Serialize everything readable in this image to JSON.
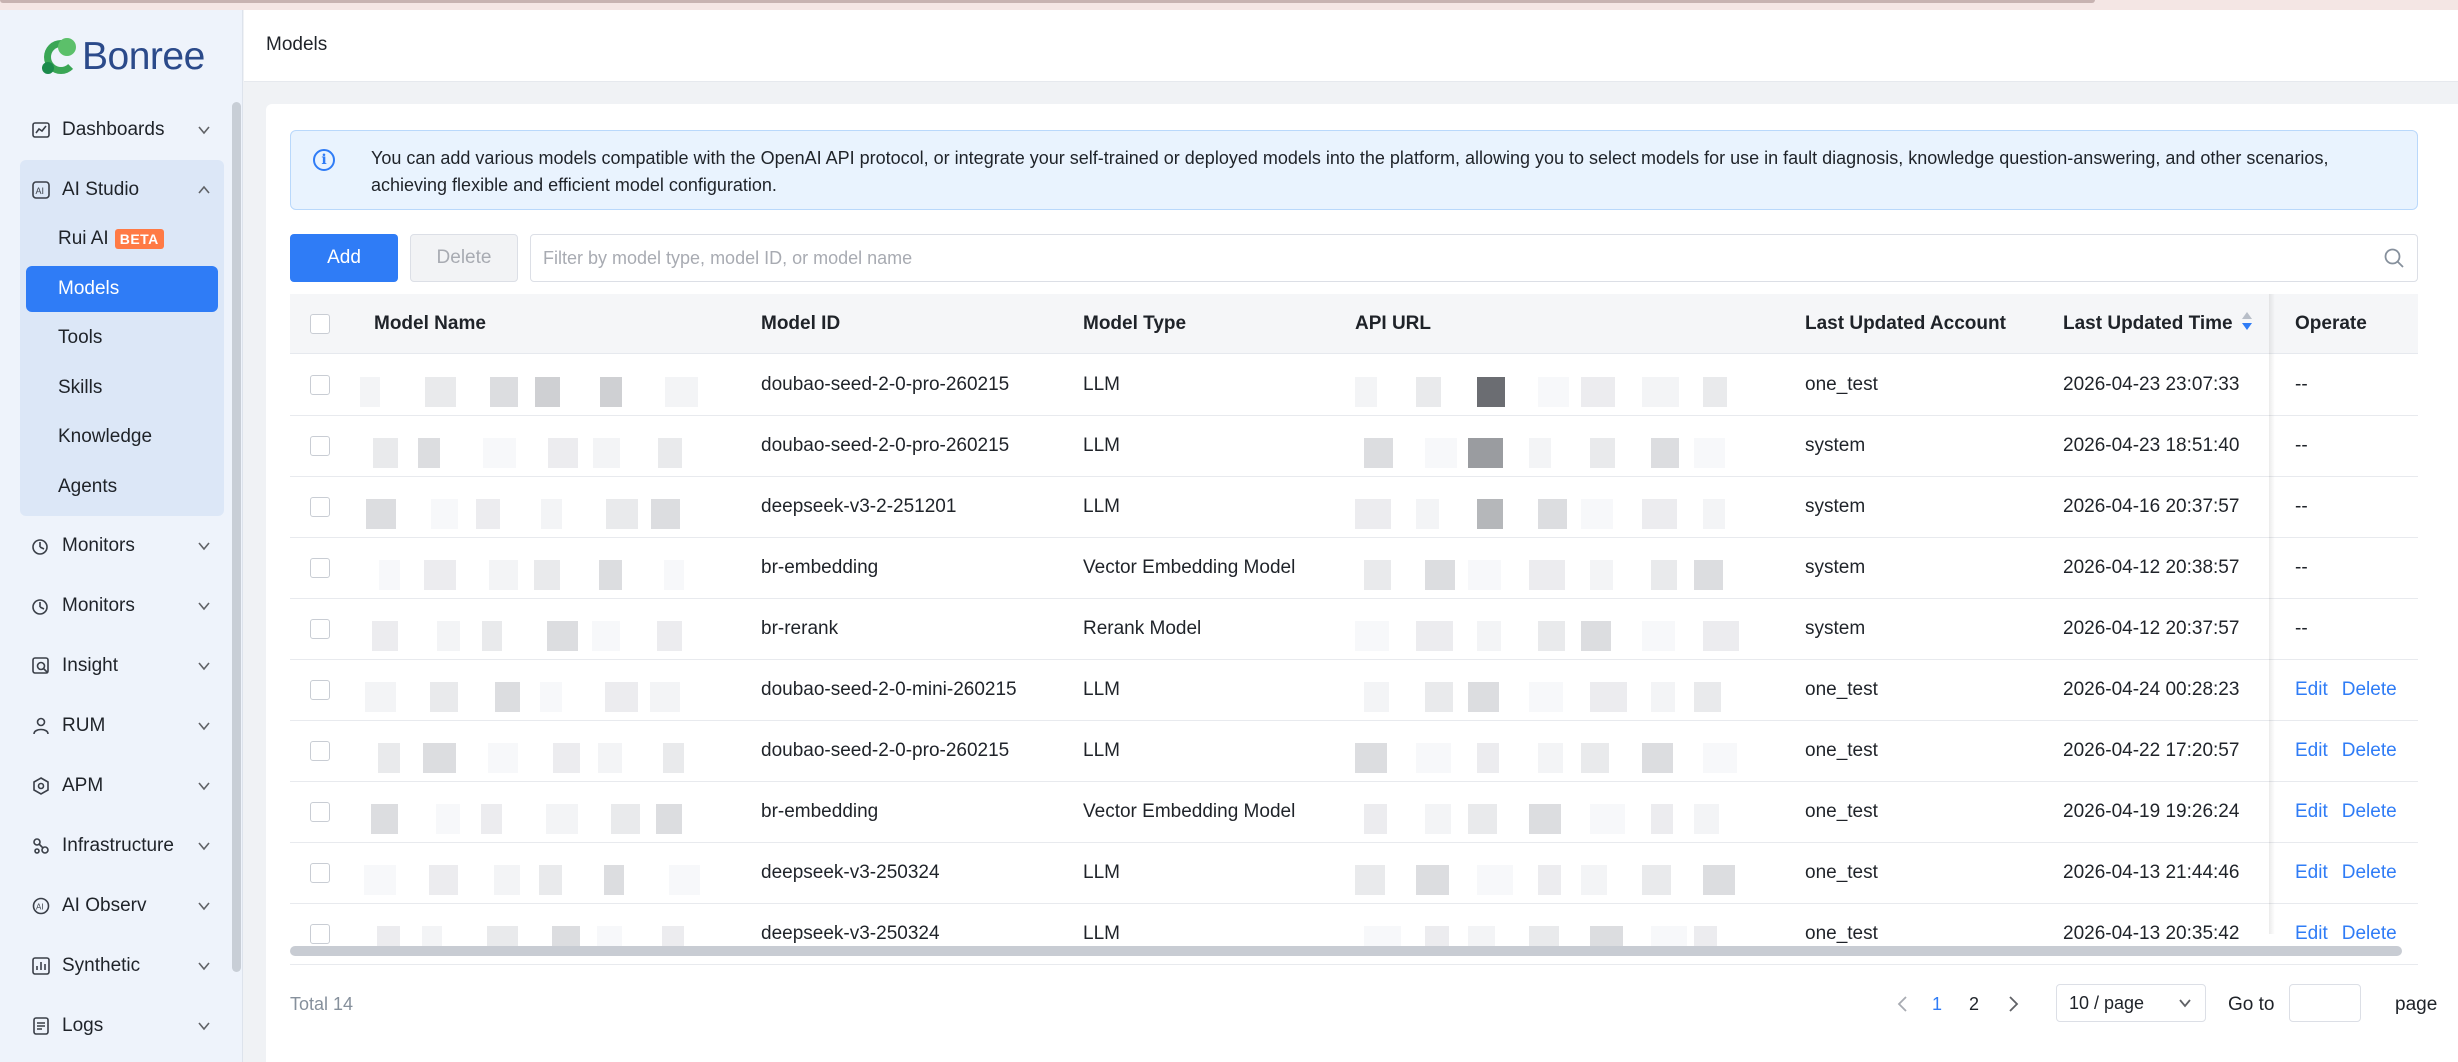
{
  "app": {
    "brand": "Bonree"
  },
  "header": {
    "title": "Models"
  },
  "sidebar": {
    "items": [
      {
        "label": "Dashboards",
        "icon": "dashboard-icon"
      },
      {
        "label": "AI Studio",
        "icon": "ai-studio-icon"
      },
      {
        "label": "Monitors",
        "icon": "monitor-icon"
      },
      {
        "label": "Monitors",
        "icon": "monitor-icon"
      },
      {
        "label": "Insight",
        "icon": "insight-icon"
      },
      {
        "label": "RUM",
        "icon": "rum-icon"
      },
      {
        "label": "APM",
        "icon": "apm-icon"
      },
      {
        "label": "Infrastructure",
        "icon": "infrastructure-icon"
      },
      {
        "label": "AI Observ",
        "icon": "ai-observ-icon"
      },
      {
        "label": "Synthetic",
        "icon": "synthetic-icon"
      },
      {
        "label": "Logs",
        "icon": "logs-icon"
      }
    ],
    "sub_items": [
      {
        "label": "Rui AI",
        "badge": "BETA"
      },
      {
        "label": "Models"
      },
      {
        "label": "Tools"
      },
      {
        "label": "Skills"
      },
      {
        "label": "Knowledge"
      },
      {
        "label": "Agents"
      }
    ]
  },
  "info": {
    "text": "You can add various models compatible with the OpenAI API protocol, or integrate your self-trained or deployed models into the platform, allowing you to select models for use in fault diagnosis, knowledge question-answering, and other scenarios, achieving flexible and efficient model configuration."
  },
  "toolbar": {
    "add_label": "Add",
    "delete_label": "Delete",
    "search_placeholder": "Filter by model type, model ID, or model name"
  },
  "table": {
    "columns": [
      "Model Name",
      "Model ID",
      "Model Type",
      "API URL",
      "Last Updated Account",
      "Last Updated Time",
      "Operate"
    ],
    "rows": [
      {
        "model_id": "doubao-seed-2-0-pro-260215",
        "type": "LLM",
        "account": "one_test",
        "time": "2026-04-23 23:07:33",
        "op": "--"
      },
      {
        "model_id": "doubao-seed-2-0-pro-260215",
        "type": "LLM",
        "account": "system",
        "time": "2026-04-23 18:51:40",
        "op": "--"
      },
      {
        "model_id": "deepseek-v3-2-251201",
        "type": "LLM",
        "account": "system",
        "time": "2026-04-16 20:37:57",
        "op": "--"
      },
      {
        "model_id": "br-embedding",
        "type": "Vector Embedding Model",
        "account": "system",
        "time": "2026-04-12 20:38:57",
        "op": "--"
      },
      {
        "model_id": "br-rerank",
        "type": "Rerank Model",
        "account": "system",
        "time": "2026-04-12 20:37:57",
        "op": "--"
      },
      {
        "model_id": "doubao-seed-2-0-mini-260215",
        "type": "LLM",
        "account": "one_test",
        "time": "2026-04-24 00:28:23",
        "edit": "Edit",
        "delete": "Delete"
      },
      {
        "model_id": "doubao-seed-2-0-pro-260215",
        "type": "LLM",
        "account": "one_test",
        "time": "2026-04-22 17:20:57",
        "edit": "Edit",
        "delete": "Delete"
      },
      {
        "model_id": "br-embedding",
        "type": "Vector Embedding Model",
        "account": "one_test",
        "time": "2026-04-19 19:26:24",
        "edit": "Edit",
        "delete": "Delete"
      },
      {
        "model_id": "deepseek-v3-250324",
        "type": "LLM",
        "account": "one_test",
        "time": "2026-04-13 21:44:46",
        "edit": "Edit",
        "delete": "Delete"
      },
      {
        "model_id": "deepseek-v3-250324",
        "type": "LLM",
        "account": "one_test",
        "time": "2026-04-13 20:35:42",
        "edit": "Edit",
        "delete": "Delete"
      }
    ]
  },
  "pagination": {
    "total": "Total 14",
    "pages": [
      "1",
      "2"
    ],
    "current": "1",
    "page_size": "10 / page",
    "goto_label": "Go to",
    "page_label": "page"
  },
  "colors": {
    "accent": "#2f7cf6",
    "beta": "#ff7a45"
  }
}
